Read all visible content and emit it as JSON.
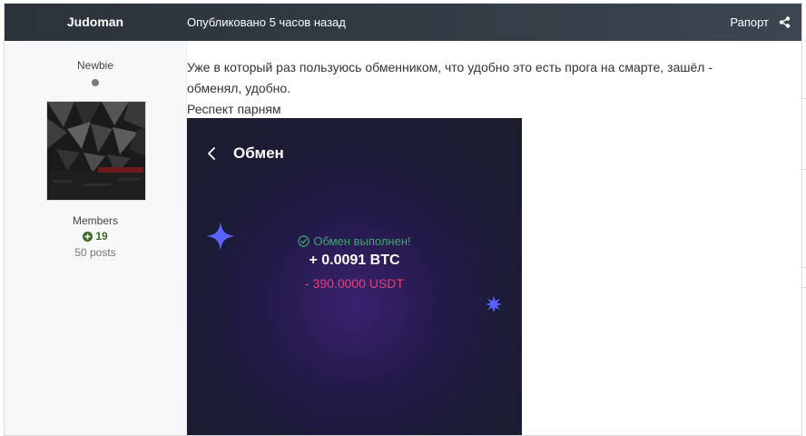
{
  "header": {
    "author": "Judoman",
    "published": "Опубликовано 5 часов назад",
    "report": "Рапорт"
  },
  "author_panel": {
    "rank": "Newbie",
    "group": "Members",
    "reputation": "19",
    "posts": "50 posts"
  },
  "post": {
    "line1": "Уже в который раз пользуюсь обменником, что удобно это есть прога на смарте, зашёл -",
    "line2": "обменял, удобно.",
    "line3": "Респект парням"
  },
  "screenshot": {
    "title": "Обмен",
    "status": "Обмен выполнен!",
    "received": "+ 0.0091 BTC",
    "spent": "- 390.0000 USDT"
  },
  "colors": {
    "header_bg": "#313a43",
    "reputation": "#3b6b1f",
    "success": "#3aa76d",
    "spent": "#e3417a",
    "sparkle": "#5b63ff"
  }
}
